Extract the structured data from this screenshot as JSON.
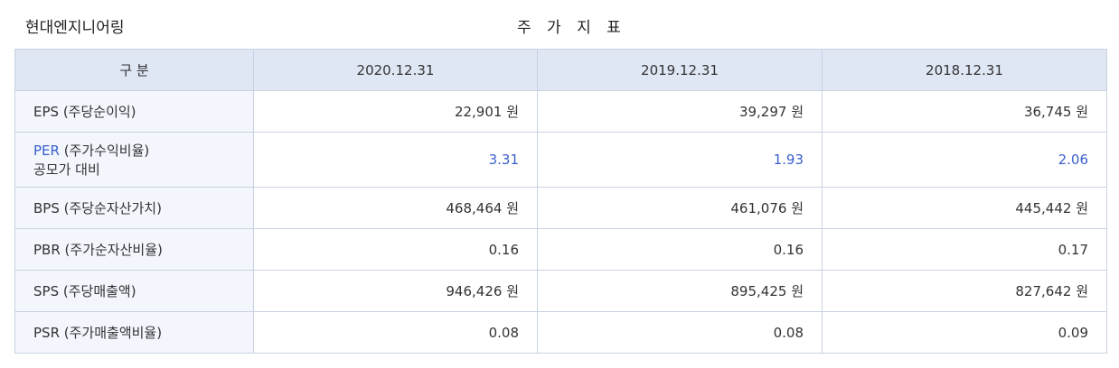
{
  "header": {
    "company": "현대엔지니어링",
    "title": "주 가 지 표"
  },
  "table": {
    "columns": [
      "구 분",
      "2020.12.31",
      "2019.12.31",
      "2018.12.31"
    ],
    "rows": [
      {
        "abbr": "EPS",
        "desc": "(주당순이익)",
        "values": [
          "22,901 원",
          "39,297 원",
          "36,745 원"
        ]
      },
      {
        "abbr": "PER",
        "desc": "(주가수익비율)",
        "sub": "공모가 대비",
        "values": [
          "3.31",
          "1.93",
          "2.06"
        ]
      },
      {
        "abbr": "BPS",
        "desc": "(주당순자산가치)",
        "values": [
          "468,464 원",
          "461,076 원",
          "445,442 원"
        ]
      },
      {
        "abbr": "PBR",
        "desc": "(주가순자산비율)",
        "values": [
          "0.16",
          "0.16",
          "0.17"
        ]
      },
      {
        "abbr": "SPS",
        "desc": "(주당매출액)",
        "values": [
          "946,426 원",
          "895,425 원",
          "827,642 원"
        ]
      },
      {
        "abbr": "PSR",
        "desc": "(주가매출액비율)",
        "values": [
          "0.08",
          "0.08",
          "0.09"
        ]
      }
    ]
  },
  "colors": {
    "link": "#3a5fcc",
    "header_bg": "#dfe6f4",
    "label_bg": "#f3f6fc",
    "border": "#c9d2e2"
  }
}
